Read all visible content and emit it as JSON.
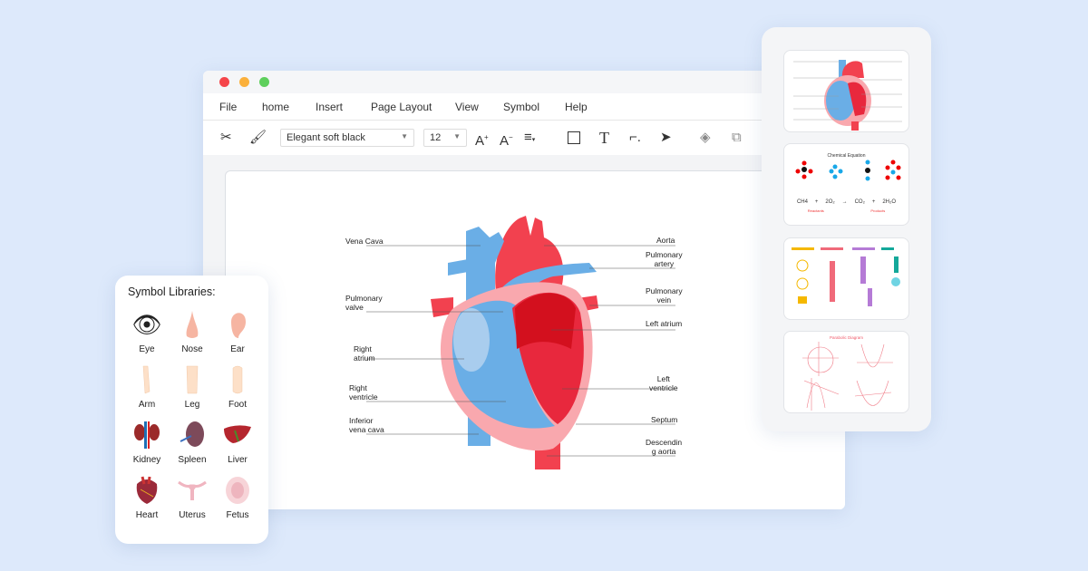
{
  "window": {
    "traffic_colors": [
      "#f5454a",
      "#fbb03b",
      "#5ecf5c"
    ]
  },
  "menu": [
    "File",
    "home",
    "Insert",
    "Page Layout",
    "View",
    "Symbol",
    "Help"
  ],
  "toolbar": {
    "font_name": "Elegant soft black",
    "font_size": "12",
    "icons": [
      "scissors-icon",
      "format-painter-icon",
      "increase-font-icon",
      "decrease-font-icon",
      "align-icon",
      "rectangle-icon",
      "text-icon",
      "connector-icon",
      "pointer-icon",
      "layers-icon",
      "group-icon"
    ]
  },
  "diagram": {
    "labels_left": [
      "Vena Cava",
      "Pulmonary\nvalve",
      "Right\natrium",
      "Right\nventricle",
      "Inferior\nvena cava"
    ],
    "labels_right": [
      "Aorta",
      "Pulmonary\nartery",
      "Pulmonary\nvein",
      "Left atrium",
      "Left\nventricle",
      "Septum",
      "Descendin\ng aorta"
    ],
    "colors": {
      "blue": "#6aaee6",
      "red": "#f2414f",
      "pink": "#f9a8ae",
      "dark_red": "#d3101e"
    }
  },
  "symbol_library": {
    "title": "Symbol Libraries:",
    "items": [
      {
        "label": "Eye"
      },
      {
        "label": "Nose"
      },
      {
        "label": "Ear"
      },
      {
        "label": "Arm"
      },
      {
        "label": "Leg"
      },
      {
        "label": "Foot"
      },
      {
        "label": "Kidney"
      },
      {
        "label": "Spleen"
      },
      {
        "label": "Liver"
      },
      {
        "label": "Heart"
      },
      {
        "label": "Uterus"
      },
      {
        "label": "Fetus"
      }
    ]
  },
  "templates": {
    "chemical": {
      "title": "Chemical Equation",
      "eq": [
        "CH4",
        "+",
        "2O₂",
        "→",
        "CO₂",
        "+",
        "2H₂O"
      ],
      "reactants": "Reactants",
      "products": "Products"
    },
    "parabolic": {
      "title": "Parabolic Diagram"
    }
  }
}
